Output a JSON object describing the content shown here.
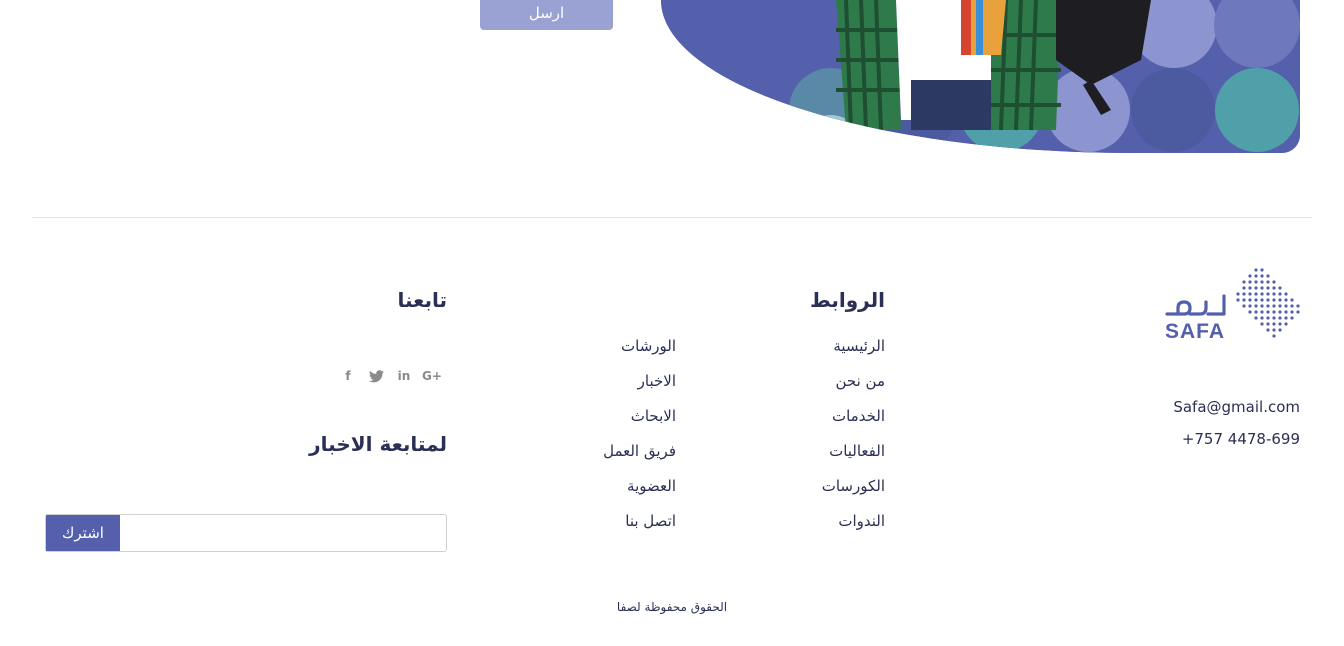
{
  "form": {
    "send_label": "ارسل"
  },
  "footer": {
    "brand": {
      "logo_text": "SAFA",
      "logo_arabic": "صفا"
    },
    "contact": {
      "email": "Safa@gmail.com",
      "phone": "+757 4478-699"
    },
    "links_heading": "الروابط",
    "links_col1": [
      "الرئيسية",
      "من نحن",
      "الخدمات",
      "الفعاليات",
      "الكورسات",
      "الندوات"
    ],
    "links_col2": [
      "الورشات",
      "الاخبار",
      "الابحاث",
      "فريق العمل",
      "العضوية",
      "اتصل بنا"
    ],
    "follow_heading": "تابعنا",
    "social_icons": [
      "google-plus-icon",
      "linkedin-icon",
      "twitter-icon",
      "facebook-icon"
    ],
    "newsletter_heading": "لمتابعة الاخبار",
    "subscribe_label": "اشترك",
    "subscribe_placeholder": "",
    "copyright": "الحقوق محفوظة لصفا"
  },
  "colors": {
    "brand": "#5560ad",
    "send_button": "#9aa1d3",
    "text": "#2b2f55",
    "icons": "#8a8a8a"
  }
}
